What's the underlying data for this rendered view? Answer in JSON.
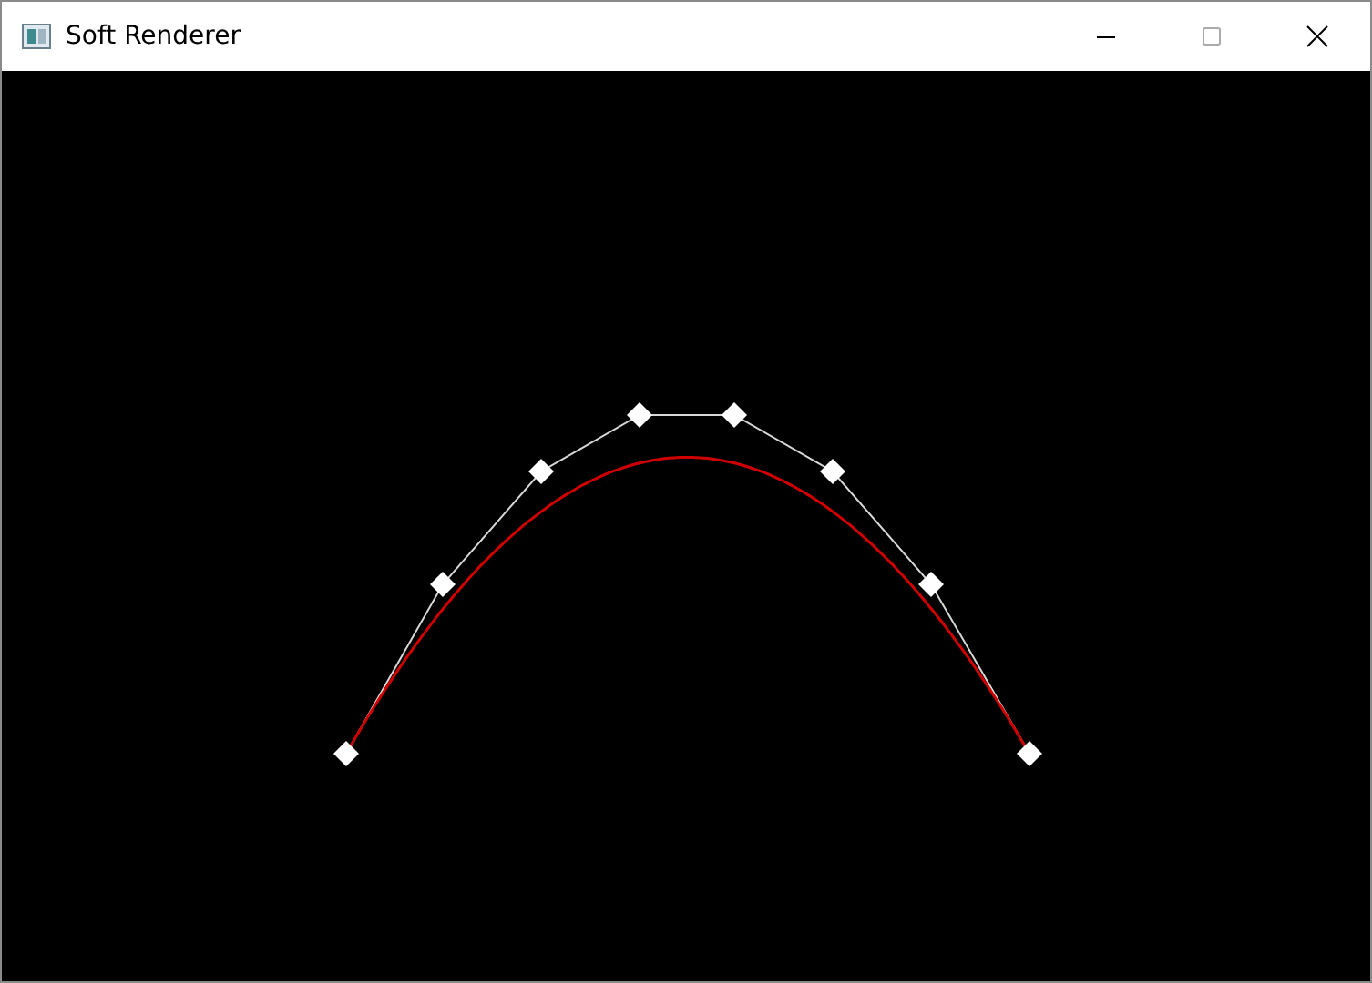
{
  "window": {
    "title": "Soft Renderer"
  }
}
